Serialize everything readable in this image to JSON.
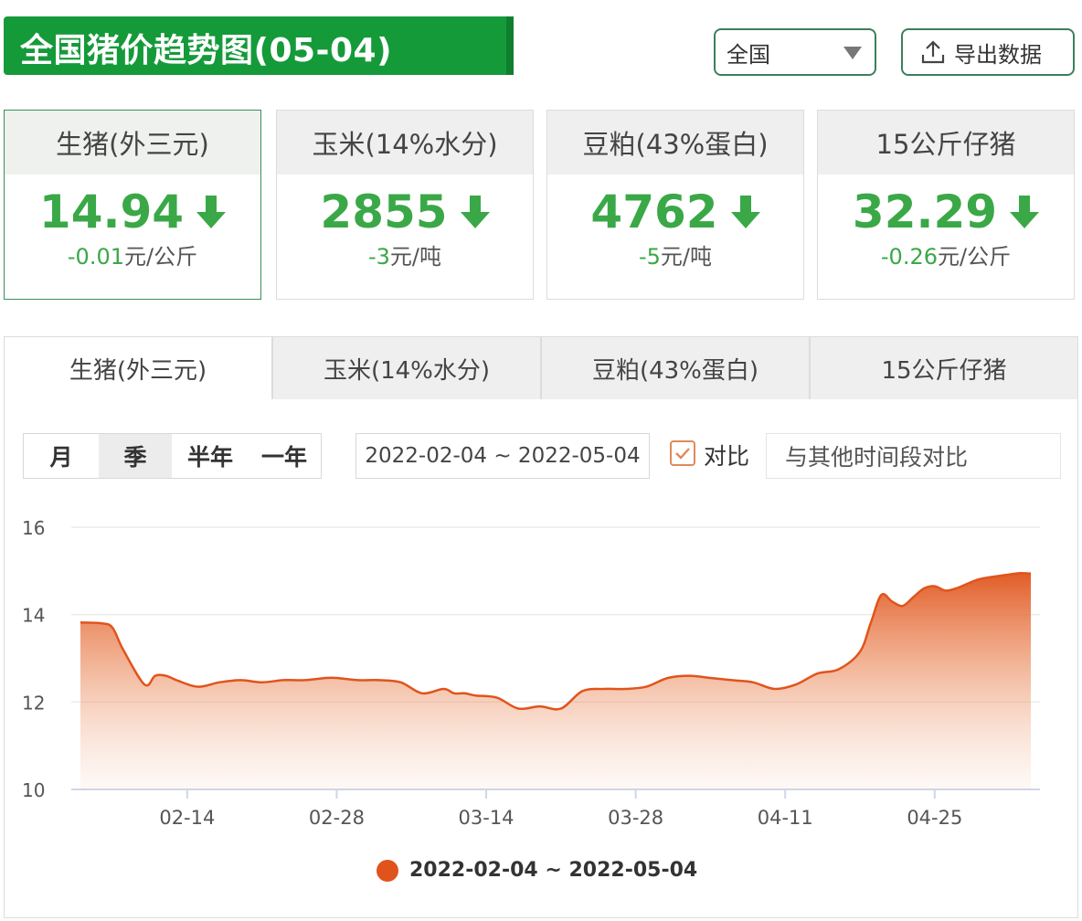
{
  "header": {
    "title": "全国猪价趋势图(05-04)",
    "region_select": "全国",
    "export_label": "导出数据"
  },
  "colors": {
    "brand_green": "#159a3a",
    "price_down_green": "#3aa847",
    "series_orange": "#e0541c"
  },
  "cards": [
    {
      "name": "生猪(外三元)",
      "value": "14.94",
      "change": "-0.01",
      "unit": "元/公斤",
      "trend": "down",
      "active": true
    },
    {
      "name": "玉米(14%水分)",
      "value": "2855",
      "change": "-3",
      "unit": "元/吨",
      "trend": "down",
      "active": false
    },
    {
      "name": "豆粕(43%蛋白)",
      "value": "4762",
      "change": "-5",
      "unit": "元/吨",
      "trend": "down",
      "active": false
    },
    {
      "name": "15公斤仔猪",
      "value": "32.29",
      "change": "-0.26",
      "unit": "元/公斤",
      "trend": "down",
      "active": false
    }
  ],
  "tabs": [
    "生猪(外三元)",
    "玉米(14%水分)",
    "豆粕(43%蛋白)",
    "15公斤仔猪"
  ],
  "controls": {
    "periods": [
      "月",
      "季",
      "半年",
      "一年"
    ],
    "active_period": "季",
    "date_range": "2022-02-04 ~ 2022-05-04",
    "compare_checked": true,
    "compare_label": "对比",
    "compare_placeholder": "与其他时间段对比"
  },
  "chart_data": {
    "type": "area",
    "title": "",
    "xlabel": "",
    "ylabel": "",
    "ylim": [
      10,
      16
    ],
    "yticks": [
      10,
      12,
      14,
      16
    ],
    "xlim": [
      "2022-02-04",
      "2022-05-04"
    ],
    "xticks": [
      "02-14",
      "02-28",
      "03-14",
      "03-28",
      "04-11",
      "04-25"
    ],
    "grid": true,
    "legend": "bottom",
    "series": [
      {
        "name": "2022-02-04 ~ 2022-05-04",
        "color": "#e0541c",
        "x": [
          "2022-02-04",
          "2022-02-06",
          "2022-02-07",
          "2022-02-08",
          "2022-02-10",
          "2022-02-11",
          "2022-02-12",
          "2022-02-13",
          "2022-02-15",
          "2022-02-17",
          "2022-02-19",
          "2022-02-21",
          "2022-02-23",
          "2022-02-25",
          "2022-02-27",
          "2022-02-28",
          "2022-03-02",
          "2022-03-04",
          "2022-03-06",
          "2022-03-08",
          "2022-03-10",
          "2022-03-11",
          "2022-03-12",
          "2022-03-13",
          "2022-03-15",
          "2022-03-17",
          "2022-03-19",
          "2022-03-21",
          "2022-03-23",
          "2022-03-25",
          "2022-03-27",
          "2022-03-29",
          "2022-03-31",
          "2022-04-02",
          "2022-04-04",
          "2022-04-06",
          "2022-04-08",
          "2022-04-10",
          "2022-04-12",
          "2022-04-14",
          "2022-04-16",
          "2022-04-18",
          "2022-04-19",
          "2022-04-20",
          "2022-04-21",
          "2022-04-22",
          "2022-04-23",
          "2022-04-24",
          "2022-04-25",
          "2022-04-26",
          "2022-04-27",
          "2022-04-28",
          "2022-04-29",
          "2022-04-30",
          "2022-05-02",
          "2022-05-03",
          "2022-05-04"
        ],
        "values": [
          13.82,
          13.8,
          13.7,
          13.2,
          12.4,
          12.6,
          12.6,
          12.5,
          12.35,
          12.45,
          12.5,
          12.45,
          12.5,
          12.5,
          12.55,
          12.55,
          12.5,
          12.5,
          12.45,
          12.2,
          12.3,
          12.2,
          12.2,
          12.15,
          12.1,
          11.85,
          11.9,
          11.85,
          12.25,
          12.3,
          12.3,
          12.35,
          12.55,
          12.6,
          12.55,
          12.5,
          12.45,
          12.3,
          12.4,
          12.65,
          12.75,
          13.15,
          13.8,
          14.45,
          14.3,
          14.2,
          14.4,
          14.6,
          14.65,
          14.55,
          14.6,
          14.7,
          14.8,
          14.85,
          14.92,
          14.95,
          14.94
        ]
      }
    ]
  }
}
